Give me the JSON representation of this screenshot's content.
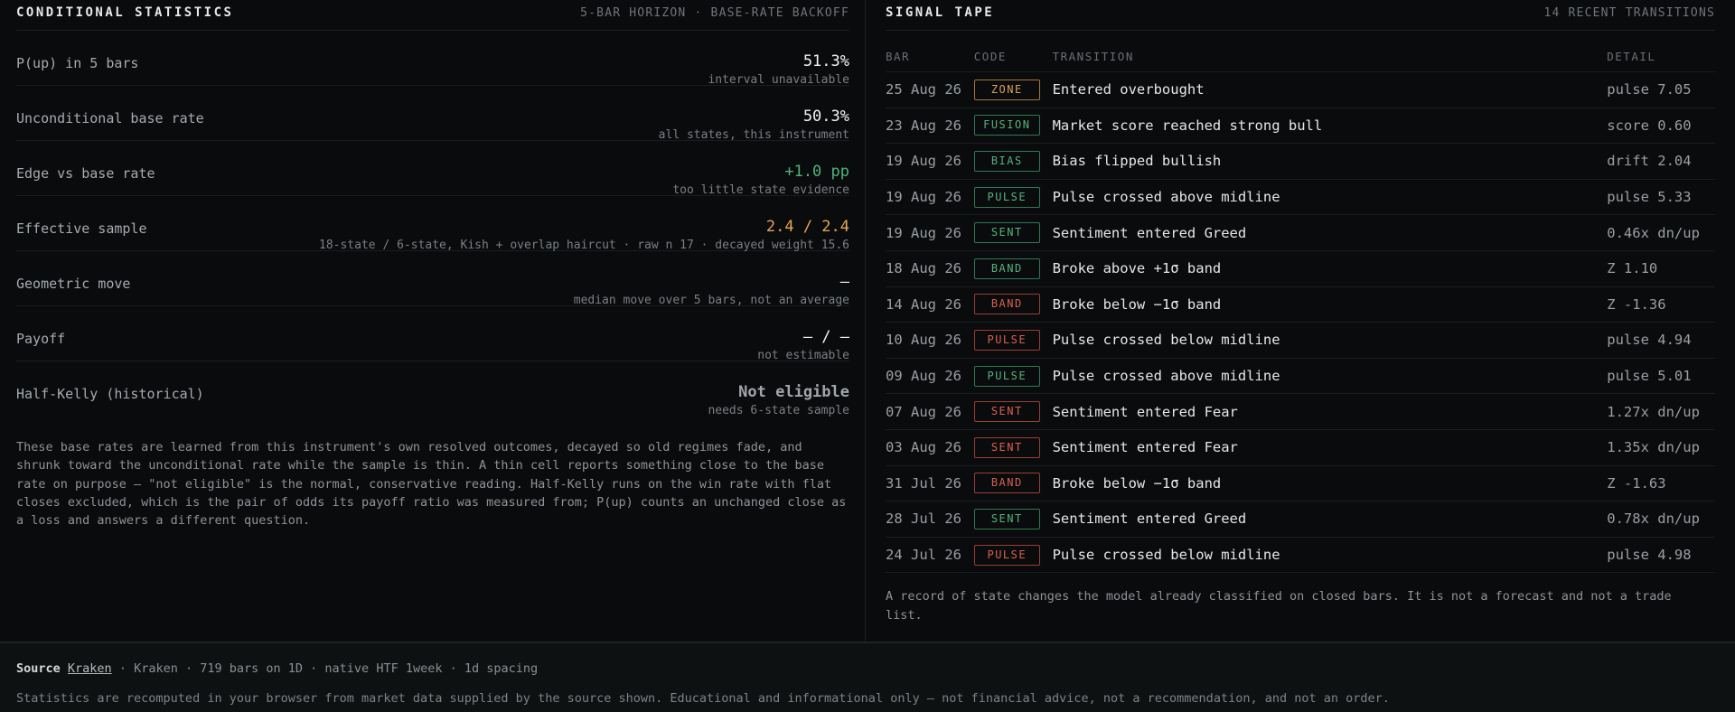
{
  "stats": {
    "title": "CONDITIONAL STATISTICS",
    "meta": "5-BAR HORIZON · BASE-RATE BACKOFF",
    "rows": [
      {
        "label": "P(up) in 5 bars",
        "value": "51.3%",
        "sub": "interval unavailable"
      },
      {
        "label": "Unconditional base rate",
        "value": "50.3%",
        "sub": "all states, this instrument"
      },
      {
        "label": "Edge vs base rate",
        "value": "+1.0 pp",
        "sub": "too little state evidence"
      },
      {
        "label": "Effective sample",
        "value": "2.4 / 2.4",
        "sub": "18-state / 6-state, Kish + overlap haircut · raw n 17 · decayed weight 15.6"
      },
      {
        "label": "Geometric move",
        "value": "—",
        "sub": "median move over 5 bars, not an average"
      },
      {
        "label": "Payoff",
        "value": "— / —",
        "sub": "not estimable"
      },
      {
        "label": "Half-Kelly (historical)",
        "value": "Not eligible",
        "sub": "needs 6-state sample"
      }
    ],
    "note": "These base rates are learned from this instrument's own resolved outcomes, decayed so old regimes fade, and shrunk toward the unconditional rate while the sample is thin. A thin cell reports something close to the base rate on purpose — \"not eligible\" is the normal, conservative reading. Half-Kelly runs on the win rate with flat closes excluded, which is the pair of odds its payoff ratio was measured from; P(up) counts an unchanged close as a loss and answers a different question."
  },
  "tape": {
    "title": "SIGNAL TAPE",
    "meta": "14 RECENT TRANSITIONS",
    "columns": {
      "bar": "BAR",
      "code": "CODE",
      "transition": "TRANSITION",
      "detail": "DETAIL"
    },
    "rows": [
      {
        "bar": "25 Aug 26",
        "code": "ZONE",
        "tone": "amber",
        "transition": "Entered overbought",
        "detail": "pulse 7.05"
      },
      {
        "bar": "23 Aug 26",
        "code": "FUSION",
        "tone": "green",
        "transition": "Market score reached strong bull",
        "detail": "score 0.60"
      },
      {
        "bar": "19 Aug 26",
        "code": "BIAS",
        "tone": "green",
        "transition": "Bias flipped bullish",
        "detail": "drift 2.04"
      },
      {
        "bar": "19 Aug 26",
        "code": "PULSE",
        "tone": "green",
        "transition": "Pulse crossed above midline",
        "detail": "pulse 5.33"
      },
      {
        "bar": "19 Aug 26",
        "code": "SENT",
        "tone": "green",
        "transition": "Sentiment entered Greed",
        "detail": "0.46x dn/up"
      },
      {
        "bar": "18 Aug 26",
        "code": "BAND",
        "tone": "green",
        "transition": "Broke above +1σ band",
        "detail": "Z 1.10"
      },
      {
        "bar": "14 Aug 26",
        "code": "BAND",
        "tone": "red",
        "transition": "Broke below −1σ band",
        "detail": "Z -1.36"
      },
      {
        "bar": "10 Aug 26",
        "code": "PULSE",
        "tone": "red",
        "transition": "Pulse crossed below midline",
        "detail": "pulse 4.94"
      },
      {
        "bar": "09 Aug 26",
        "code": "PULSE",
        "tone": "green",
        "transition": "Pulse crossed above midline",
        "detail": "pulse 5.01"
      },
      {
        "bar": "07 Aug 26",
        "code": "SENT",
        "tone": "red",
        "transition": "Sentiment entered Fear",
        "detail": "1.27x dn/up"
      },
      {
        "bar": "03 Aug 26",
        "code": "SENT",
        "tone": "red",
        "transition": "Sentiment entered Fear",
        "detail": "1.35x dn/up"
      },
      {
        "bar": "31 Jul 26",
        "code": "BAND",
        "tone": "red",
        "transition": "Broke below −1σ band",
        "detail": "Z -1.63"
      },
      {
        "bar": "28 Jul 26",
        "code": "SENT",
        "tone": "green",
        "transition": "Sentiment entered Greed",
        "detail": "0.78x dn/up"
      },
      {
        "bar": "24 Jul 26",
        "code": "PULSE",
        "tone": "red",
        "transition": "Pulse crossed below midline",
        "detail": "pulse 4.98"
      }
    ],
    "note": "A record of state changes the model already classified on closed bars. It is not a forecast and not a trade list."
  },
  "footer": {
    "source_label": "Source",
    "source_link": "Kraken",
    "source_detail": "· Kraken · 719 bars on 1D · native HTF 1week · 1d spacing",
    "disclaimer": "Statistics are recomputed in your browser from market data supplied by the source shown. Educational and informational only — not financial advice, not a recommendation, and not an order."
  },
  "colors": {
    "green": "#4fb37f",
    "amber": "#e8a550",
    "red": "#d9604f",
    "background": "#0a0b0c"
  }
}
